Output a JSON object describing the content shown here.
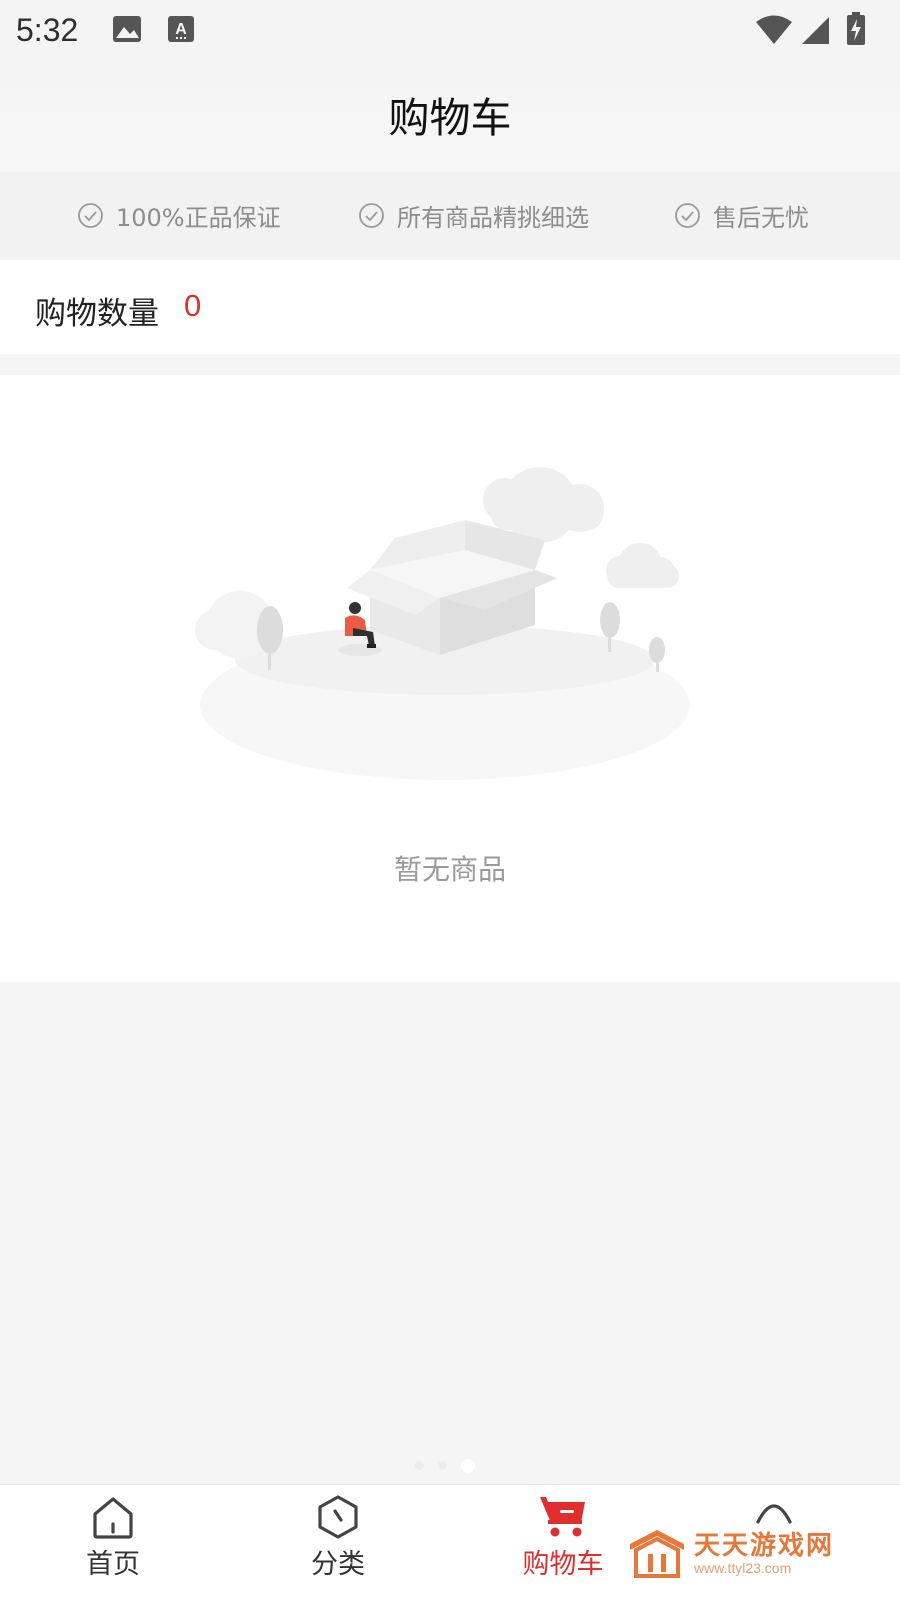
{
  "status_bar": {
    "time": "5:32",
    "icons": [
      "image-icon",
      "a-notification-icon",
      "wifi-icon",
      "signal-icon",
      "battery-charging-icon"
    ]
  },
  "header": {
    "title": "购物车"
  },
  "guarantees": [
    {
      "icon": "check-circle-icon",
      "label": "100%正品保证"
    },
    {
      "icon": "check-circle-icon",
      "label": "所有商品精挑细选"
    },
    {
      "icon": "check-circle-icon",
      "label": "售后无忧"
    }
  ],
  "cart": {
    "quantity_label": "购物数量",
    "quantity_value": "0"
  },
  "empty_state": {
    "message": "暂无商品",
    "illustration": "empty-box-illustration"
  },
  "bottom_nav": {
    "items": [
      {
        "label": "首页",
        "icon": "home-icon",
        "active": false
      },
      {
        "label": "分类",
        "icon": "category-icon",
        "active": false
      },
      {
        "label": "购物车",
        "icon": "cart-icon",
        "active": true
      },
      {
        "label": "",
        "icon": "profile-icon",
        "active": false
      }
    ]
  },
  "watermark": {
    "title": "天天游戏网",
    "url": "www.ttyl23.com"
  },
  "colors": {
    "accent": "#e02e2e",
    "quantity": "#d8322b",
    "muted_text": "#8d8d8d",
    "background": "#f5f5f5"
  }
}
